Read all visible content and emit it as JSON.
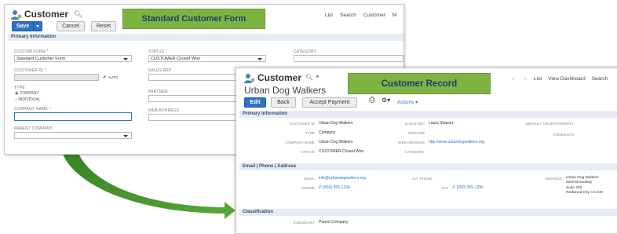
{
  "win1": {
    "title": "Customer",
    "banner": "Standard Customer Form",
    "nav": [
      "List",
      "Search",
      "Customer",
      "M"
    ],
    "buttons": {
      "save": "Save",
      "cancel": "Cancel",
      "reset": "Reset"
    },
    "section": "Primary Information",
    "fields": {
      "custom_form_label": "CUSTOM FORM *",
      "custom_form_value": "Standard Customer Form",
      "customer_id_label": "CUSTOMER ID *",
      "auto_label": "AUTO",
      "type_label": "TYPE",
      "type_company": "COMPANY",
      "type_individual": "INDIVIDUAL",
      "company_name_label": "COMPANY NAME *",
      "parent_company_label": "PARENT COMPANY",
      "status_label": "STATUS *",
      "status_value": "CUSTOMER-Closed Won",
      "sales_rep_label": "SALES REP",
      "partner_label": "PARTNER",
      "web_address_label": "WEB ADDRESS",
      "category_label": "CATEGORY"
    }
  },
  "win2": {
    "title": "Customer",
    "banner": "Customer Record",
    "record_name": "Urban Dog Walkers",
    "nav": [
      "List",
      "View Dashboard",
      "Search"
    ],
    "buttons": {
      "edit": "Edit",
      "back": "Back",
      "accept_payment": "Accept Payment",
      "actions": "Actions"
    },
    "sections": {
      "primary": "Primary Information",
      "contact": "Email | Phone | Address",
      "classification": "Classification"
    },
    "primary": {
      "customer_id_label": "CUSTOMER ID",
      "customer_id": "Urban Dog Walkers",
      "type_label": "TYPE",
      "type": "Company",
      "company_name_label": "COMPANY NAME",
      "company_name": "Urban Dog Walkers",
      "status_label": "STATUS",
      "status": "CUSTOMER-Closed Won",
      "sales_rep_label": "SALES REP",
      "sales_rep": "Laura Stewart",
      "partner_label": "PARTNER",
      "web_address_label": "WEB ADDRESS",
      "web_address": "http://www.urbandogwalkers.org",
      "category_label": "CATEGORY",
      "default_order_priority_label": "DEFAULT ORDER PRIORITY",
      "comments_label": "COMMENTS"
    },
    "contact": {
      "email_label": "EMAIL",
      "email": "info@urbandogwalkers.org",
      "phone_label": "PHONE",
      "phone": "(650) 555-1234",
      "alt_phone_label": "ALT. PHONE",
      "fax_label": "FAX",
      "fax": "(650) 555-1290",
      "address_label": "ADDRESS",
      "address_lines": [
        "Urban Dog Walkers",
        "2200 Broadway",
        "Suite 200",
        "Redwood City CA 940"
      ]
    },
    "classification": {
      "subsidiary_label": "SUBSIDIARY",
      "subsidiary": "Parent Company"
    }
  },
  "colors": {
    "accent": "#2f73c7",
    "banner_green": "#7cb342",
    "arrow_green": "#3f8f2a"
  }
}
